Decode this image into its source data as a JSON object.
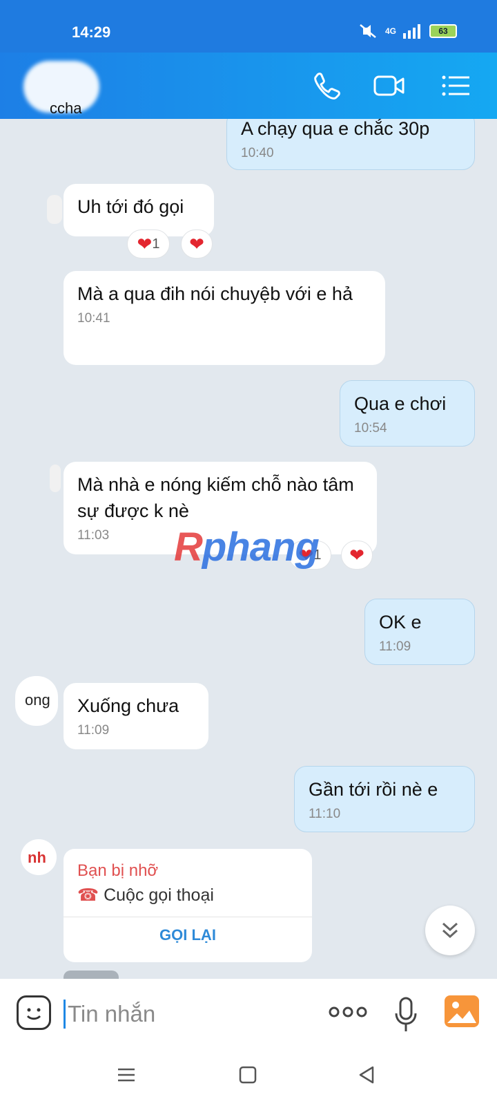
{
  "status_bar": {
    "time": "14:29",
    "network": "4G",
    "battery": "63"
  },
  "header": {
    "contact_name": "ccha"
  },
  "messages": [
    {
      "text": "A chạy qua e chắc 30p",
      "time": "10:40"
    },
    {
      "text": "Uh tới đó gọi",
      "reaction_count": "1"
    },
    {
      "text": "Mà a qua đih nói chuyệb với e hả",
      "time": "10:41"
    },
    {
      "text": "Qua e chơi",
      "time": "10:54"
    },
    {
      "text": "Mà nhà e nóng kiếm chỗ nào tâm sự được k nè",
      "time": "11:03",
      "reaction_count": "1"
    },
    {
      "text": "OK e",
      "time": "11:09"
    },
    {
      "text": "Xuống chưa",
      "time": "11:09"
    },
    {
      "text": "Gần tới rồi nè e",
      "time": "11:10"
    }
  ],
  "avatars": {
    "a1": "ong",
    "a2": "nh"
  },
  "missed_call": {
    "title": "Bạn bị nhỡ",
    "type": "Cuộc gọi thoại",
    "action": "GỌI LẠI",
    "icon": "missed-call-icon"
  },
  "watermark": {
    "first": "R",
    "rest": "phang"
  },
  "input": {
    "placeholder": "Tin nhắn"
  },
  "colors": {
    "header": "#1d7fe6",
    "outgoing_bubble": "#d7edfc",
    "incoming_bubble": "#ffffff",
    "background": "#e2e8ee",
    "missed_call": "#e05050",
    "accent": "#2e8ad8"
  }
}
